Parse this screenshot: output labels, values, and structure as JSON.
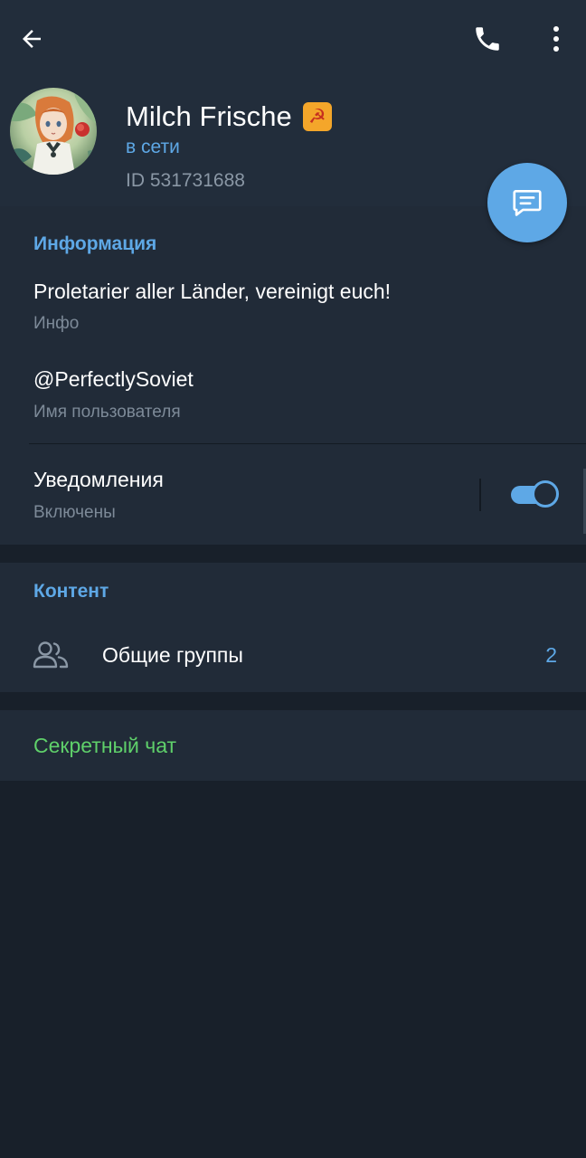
{
  "header": {
    "back_icon": "arrow-left-icon",
    "call_icon": "phone-icon",
    "menu_icon": "more-vertical-icon"
  },
  "profile": {
    "name": "Milch Frische",
    "emoji_badge": "☭",
    "status": "в сети",
    "user_id": "ID 531731688",
    "avatar": "anime-girl-avatar",
    "fab_icon": "message-icon"
  },
  "info_section": {
    "title": "Информация",
    "bio": "Proletarier aller Länder, vereinigt euch!",
    "bio_label": "Инфо",
    "username": "@PerfectlySoviet",
    "username_label": "Имя пользователя",
    "notifications": "Уведомления",
    "notifications_status": "Включены",
    "notifications_enabled": true
  },
  "content_section": {
    "title": "Контент",
    "groups_label": "Общие группы",
    "groups_count": "2",
    "groups_icon": "users-icon"
  },
  "secret_section": {
    "label": "Секретный чат"
  },
  "colors": {
    "background": "#18202a",
    "surface": "#212b38",
    "accent": "#5ea8e6",
    "secret_green": "#5fd06a",
    "muted": "#7d8a98"
  }
}
